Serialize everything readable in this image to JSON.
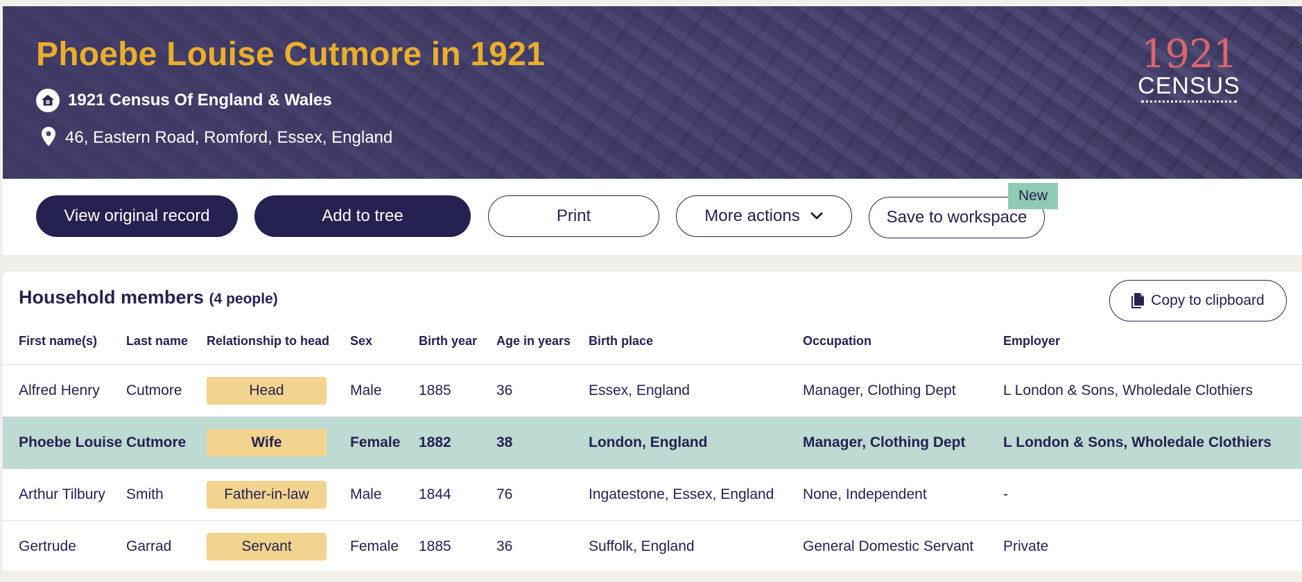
{
  "header": {
    "title": "Phoebe Louise Cutmore in 1921",
    "collection": "1921 Census Of England & Wales",
    "address": "46, Eastern Road, Romford, Essex, England",
    "logo_year": "1921",
    "logo_word": "CENSUS"
  },
  "actions": {
    "view_original": "View original record",
    "add_to_tree": "Add to tree",
    "print": "Print",
    "more_actions": "More actions",
    "save_workspace": "Save to workspace",
    "new_badge": "New"
  },
  "household": {
    "title": "Household members",
    "count": "(4 people)",
    "copy_label": "Copy to clipboard",
    "columns": [
      "First name(s)",
      "Last name",
      "Relationship to head",
      "Sex",
      "Birth year",
      "Age in years",
      "Birth place",
      "Occupation",
      "Employer"
    ],
    "rows": [
      [
        "Alfred Henry",
        "Cutmore",
        "Head",
        "Male",
        "1885",
        "36",
        "Essex, England",
        "Manager, Clothing Dept",
        "L London & Sons, Wholedale Clothiers"
      ],
      [
        "Phoebe Louise",
        "Cutmore",
        "Wife",
        "Female",
        "1882",
        "38",
        "London, England",
        "Manager, Clothing Dept",
        "L London & Sons, Wholedale Clothiers"
      ],
      [
        "Arthur Tilbury",
        "Smith",
        "Father-in-law",
        "Male",
        "1844",
        "76",
        "Ingatestone, Essex, England",
        "None, Independent",
        "-"
      ],
      [
        "Gertrude",
        "Garrad",
        "Servant",
        "Female",
        "1885",
        "36",
        "Suffolk, England",
        "General Domestic Servant",
        "Private"
      ]
    ]
  },
  "colors": {
    "navy": "#252150",
    "gold_title": "#eaae2a",
    "relationship_pill": "#f2d48e",
    "highlight_row": "#bddad3",
    "new_badge": "#8fcbb3",
    "logo_red": "#d9676c"
  },
  "icons": {
    "collection": "home-icon",
    "address": "map-pin-icon",
    "more_actions": "chevron-down-icon",
    "copy": "document-copy-icon"
  }
}
